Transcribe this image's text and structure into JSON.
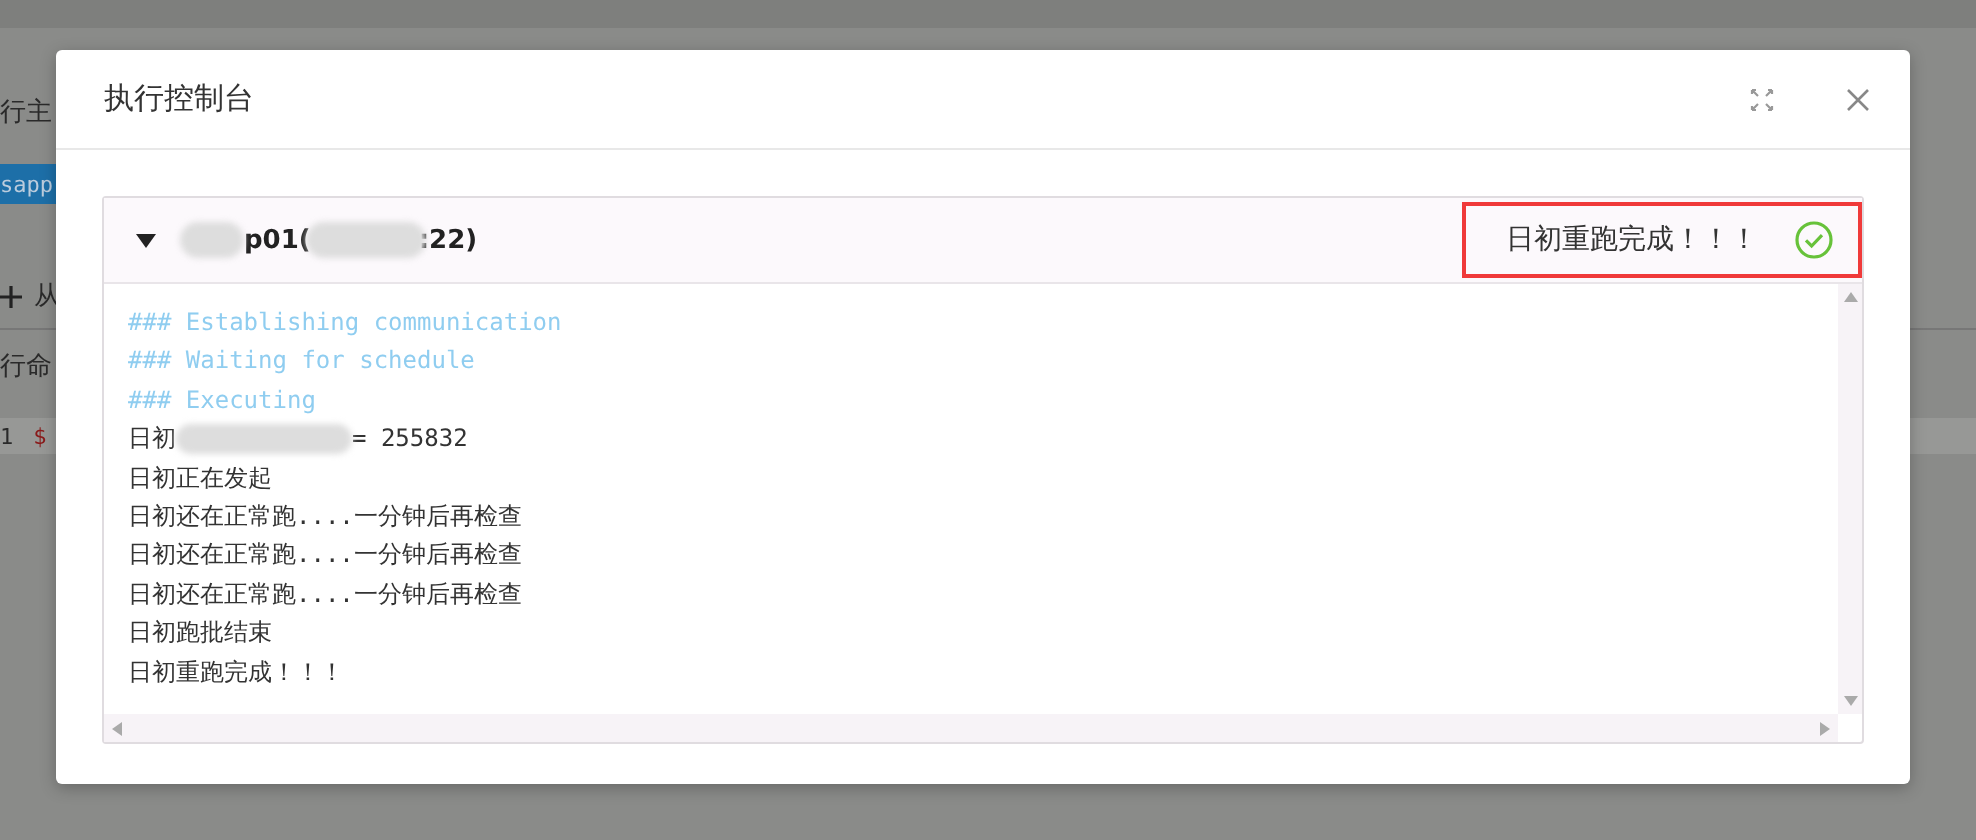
{
  "background": [
    {
      "kind": "label",
      "text": "行主"
    },
    {
      "kind": "selected",
      "text": "sapp"
    },
    {
      "kind": "add",
      "text": "从"
    },
    {
      "kind": "label",
      "text": "行命"
    },
    {
      "kind": "code",
      "line": "1",
      "text": "$"
    }
  ],
  "dialog": {
    "title": "执行控制台",
    "host": {
      "parts": [
        "p01(",
        ":22)"
      ],
      "expanded": true
    },
    "status": {
      "text": "日初重跑完成！！！",
      "success": true,
      "highlighted": true
    },
    "log": [
      {
        "kind": "system",
        "text": "### Establishing communication"
      },
      {
        "kind": "system",
        "text": "### Waiting for schedule"
      },
      {
        "kind": "system",
        "text": "### Executing"
      },
      {
        "kind": "masked",
        "prefix": "日初",
        "suffix": "= 255832"
      },
      {
        "kind": "output",
        "text": "日初正在发起"
      },
      {
        "kind": "output",
        "text": "日初还在正常跑....一分钟后再检查"
      },
      {
        "kind": "output",
        "text": "日初还在正常跑....一分钟后再检查"
      },
      {
        "kind": "output",
        "text": "日初还在正常跑....一分钟后再检查"
      },
      {
        "kind": "output",
        "text": "日初跑批结束"
      },
      {
        "kind": "output",
        "text": "日初重跑完成！！！"
      }
    ]
  }
}
